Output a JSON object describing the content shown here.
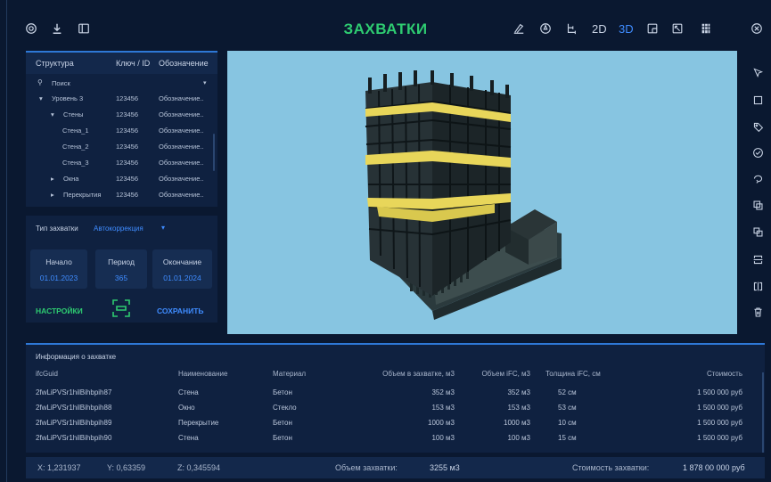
{
  "header": {
    "title": "ЗАХВАТКИ",
    "view_2d": "2D",
    "view_3d": "3D"
  },
  "tree": {
    "columns": [
      "Структура",
      "Ключ / ID",
      "Обозначение"
    ],
    "search_placeholder": "Поиск",
    "rows": [
      {
        "name": "Уровень 3",
        "id": "123456",
        "desc": "Обозначение..",
        "expand": "▾"
      },
      {
        "name": "Стены",
        "id": "123456",
        "desc": "Обозначение..",
        "expand": "▾"
      },
      {
        "name": "Стена_1",
        "id": "123456",
        "desc": "Обозначение..",
        "expand": ""
      },
      {
        "name": "Стена_2",
        "id": "123456",
        "desc": "Обозначение..",
        "expand": ""
      },
      {
        "name": "Стена_3",
        "id": "123456",
        "desc": "Обозначение..",
        "expand": ""
      },
      {
        "name": "Окна",
        "id": "123456",
        "desc": "Обозначение..",
        "expand": "▸"
      },
      {
        "name": "Перекрытия",
        "id": "123456",
        "desc": "Обозначение..",
        "expand": "▸"
      }
    ]
  },
  "zakhvatka": {
    "type_label": "Тип захватки",
    "type_value": "Автокоррекция",
    "start_label": "Начало",
    "start_value": "01.01.2023",
    "period_label": "Период",
    "period_value": "365",
    "end_label": "Окончание",
    "end_value": "01.01.2024",
    "settings_label": "НАСТРОЙКИ",
    "save_label": "СОХРАНИТЬ"
  },
  "info": {
    "title": "Информация о захватке",
    "columns": [
      "ifcGuid",
      "Наименование",
      "Материал",
      "Объем в захватке, м3",
      "Объем iFC, м3",
      "Толщина iFC, см",
      "Стоимость"
    ],
    "rows": [
      [
        "2fwLiPVSr1hilBihbpih87",
        "Стена",
        "Бетон",
        "352 м3",
        "352 м3",
        "52 см",
        "1 500 000 руб"
      ],
      [
        "2fwLiPVSr1hilBihbpih88",
        "Окно",
        "Стекло",
        "153 м3",
        "153 м3",
        "53 см",
        "1 500 000 руб"
      ],
      [
        "2fwLiPVSr1hilBihbpih89",
        "Перекрытие",
        "Бетон",
        "1000 м3",
        "1000 м3",
        "10 см",
        "1 500 000 руб"
      ],
      [
        "2fwLiPVSr1hilBihbpih90",
        "Стена",
        "Бетон",
        "100 м3",
        "100 м3",
        "15 см",
        "1 500 000 руб"
      ]
    ]
  },
  "status": {
    "x": "X: 1,231937",
    "y": "Y: 0,63359",
    "z": "Z: 0,345594",
    "volume_label": "Объем захватки:",
    "volume_value": "3255 м3",
    "cost_label": "Стоимость захватки:",
    "cost_value": "1 878 00 000 руб"
  },
  "colors": {
    "background": "#0a1830",
    "panel": "#0f2140",
    "accent_blue": "#3f8cff",
    "accent_green": "#2ecc71",
    "viewport_sky": "#87c5e1",
    "building_yellow": "#e8d65a"
  }
}
